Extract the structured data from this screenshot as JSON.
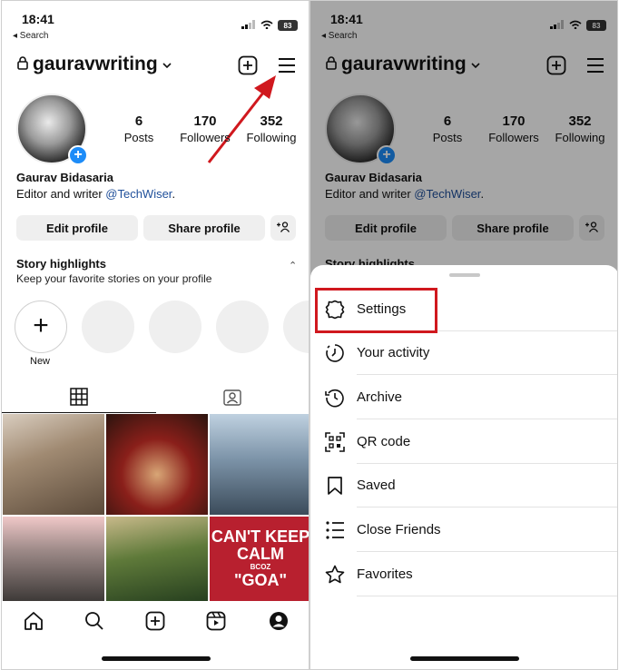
{
  "status": {
    "time": "18:41",
    "back_label": "◂ Search",
    "battery": "83"
  },
  "profile": {
    "username": "gauravwriting",
    "posts": "6",
    "posts_label": "Posts",
    "followers": "170",
    "followers_label": "Followers",
    "following": "352",
    "following_label": "Following",
    "name": "Gaurav Bidasaria",
    "bio_prefix": "Editor and writer ",
    "bio_link": "@TechWiser",
    "bio_suffix": ".",
    "edit_label": "Edit profile",
    "share_label": "Share profile"
  },
  "highlights": {
    "title": "Story highlights",
    "subtitle": "Keep your favorite stories on your profile",
    "new_label": "New"
  },
  "grid_post": {
    "line1": "CAN'T KEEP",
    "line2": "CALM",
    "line3": "BCOZ",
    "line4": "\"GOA\""
  },
  "menu": {
    "items": [
      {
        "label": "Settings",
        "icon": "settings-icon"
      },
      {
        "label": "Your activity",
        "icon": "activity-icon"
      },
      {
        "label": "Archive",
        "icon": "archive-icon"
      },
      {
        "label": "QR code",
        "icon": "qr-code-icon"
      },
      {
        "label": "Saved",
        "icon": "bookmark-icon"
      },
      {
        "label": "Close Friends",
        "icon": "close-friends-icon"
      },
      {
        "label": "Favorites",
        "icon": "star-icon"
      }
    ]
  },
  "colors": {
    "accent_blue": "#1d8cf8",
    "annotation_red": "#d0181e",
    "link": "#1f4f9a"
  }
}
